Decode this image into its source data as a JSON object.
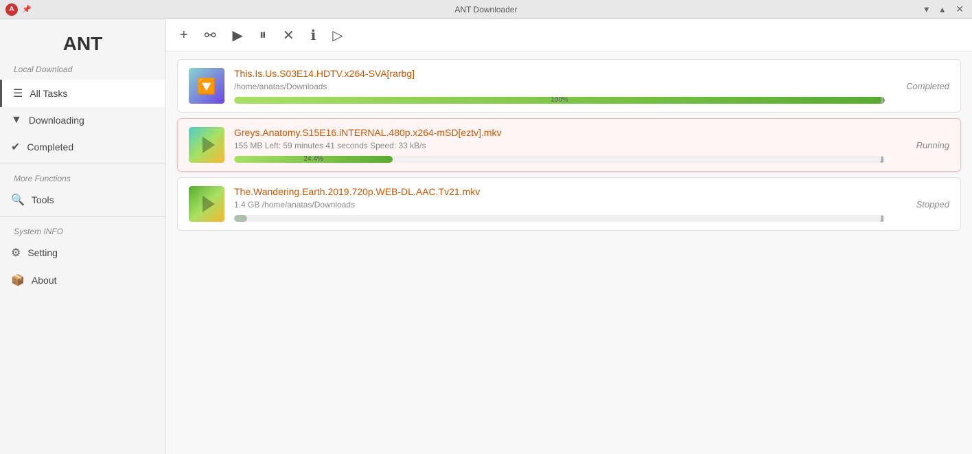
{
  "titlebar": {
    "title": "ANT Downloader",
    "controls": [
      "▾",
      "▴",
      "✕"
    ],
    "logo_text": "A"
  },
  "sidebar": {
    "brand": "ANT",
    "local_download_label": "Local Download",
    "items": [
      {
        "id": "all-tasks",
        "label": "All Tasks",
        "icon": "☰",
        "active": true
      },
      {
        "id": "downloading",
        "label": "Downloading",
        "icon": "▼",
        "active": false
      },
      {
        "id": "completed",
        "label": "Completed",
        "icon": "✔",
        "active": false
      }
    ],
    "more_functions_label": "More Functions",
    "more_items": [
      {
        "id": "tools",
        "label": "Tools",
        "icon": "🔍",
        "active": false
      }
    ],
    "system_info_label": "System INFO",
    "system_items": [
      {
        "id": "setting",
        "label": "Setting",
        "icon": "⚙",
        "active": false
      },
      {
        "id": "about",
        "label": "About",
        "icon": "📦",
        "active": false
      }
    ]
  },
  "toolbar": {
    "buttons": [
      {
        "id": "add",
        "symbol": "+",
        "title": "Add"
      },
      {
        "id": "magnet",
        "symbol": "⚯",
        "title": "Magnet Link"
      },
      {
        "id": "play",
        "symbol": "▶",
        "title": "Play"
      },
      {
        "id": "pause",
        "symbol": "⏸",
        "title": "Pause"
      },
      {
        "id": "delete",
        "symbol": "✕",
        "title": "Delete"
      },
      {
        "id": "info",
        "symbol": "ℹ",
        "title": "Info"
      },
      {
        "id": "play2",
        "symbol": "▷",
        "title": "Open"
      }
    ]
  },
  "downloads": [
    {
      "id": "item1",
      "title": "This.Is.Us.S03E14.HDTV.x264-SVA[rarbg]",
      "path": "/home/anatas/Downloads",
      "status": "Completed",
      "progress": 100,
      "progress_label": "100%",
      "active": false,
      "thumb_type": "torrent"
    },
    {
      "id": "item2",
      "title": "Greys.Anatomy.S15E16.iNTERNAL.480p.x264-mSD[eztv].mkv",
      "subtitle": "155 MB Left: 59 minutes 41 seconds  Speed: 33 kB/s",
      "status": "Running",
      "progress": 24.4,
      "progress_label": "24.4%",
      "active": true,
      "thumb_type": "video"
    },
    {
      "id": "item3",
      "title": "The.Wandering.Earth.2019.720p.WEB-DL.AAC.Tv21.mkv",
      "subtitle": "1.4 GB  /home/anatas/Downloads",
      "status": "Stopped",
      "progress": 2,
      "progress_label": "",
      "active": false,
      "thumb_type": "video"
    }
  ]
}
